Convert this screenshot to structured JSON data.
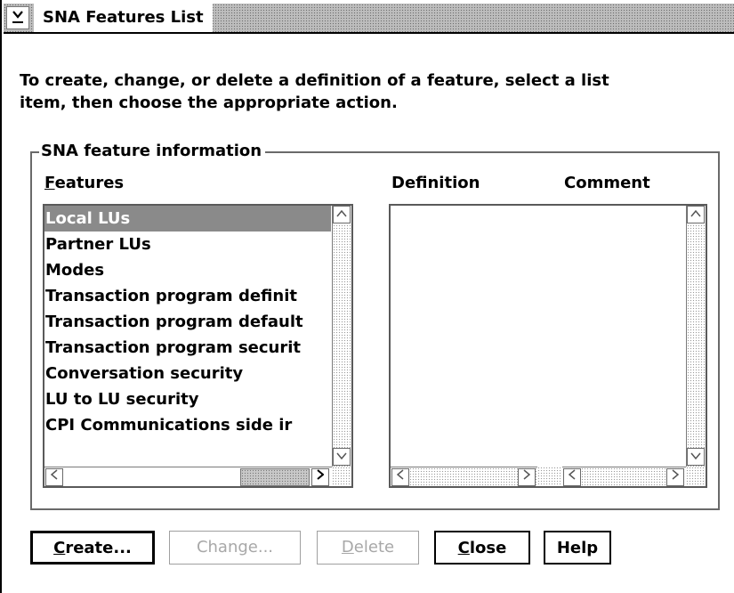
{
  "window": {
    "title": "SNA Features List",
    "instructions": "To create, change, or delete a definition of a feature, select a list\nitem, then choose the appropriate action."
  },
  "group": {
    "legend": "SNA feature information"
  },
  "features": {
    "label_mnemonic": "F",
    "label_rest": "eatures",
    "items": [
      "Local LUs",
      "Partner LUs",
      "Modes",
      "Transaction program definit",
      "Transaction program default",
      "Transaction program securit",
      "Conversation security",
      "LU to LU security",
      "CPI Communications side ir"
    ],
    "selected": "Local LUs"
  },
  "details": {
    "definition_header": "Definition",
    "comment_header": "Comment"
  },
  "buttons": {
    "create": {
      "mnemonic": "C",
      "rest": "reate...",
      "enabled": true
    },
    "change": {
      "mnemonic": "",
      "rest": "Change...",
      "enabled": false
    },
    "delete": {
      "mnemonic": "D",
      "rest": "elete",
      "enabled": false
    },
    "close": {
      "mnemonic": "C",
      "rest": "lose",
      "enabled": true
    },
    "help": {
      "label": "Help",
      "enabled": true
    }
  },
  "icons": {
    "system_menu": "system-menu-icon",
    "scroll_up": "arrow-up-icon",
    "scroll_down": "arrow-down-icon",
    "scroll_left": "arrow-left-icon",
    "scroll_right": "arrow-right-icon"
  },
  "colors": {
    "selection": "#8a8a8a",
    "disabled_text": "#a8a8a8"
  }
}
